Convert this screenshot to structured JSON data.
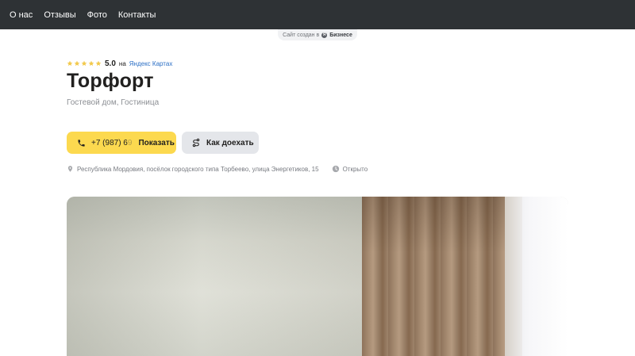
{
  "nav": {
    "items": [
      "О нас",
      "Отзывы",
      "Фото",
      "Контакты"
    ]
  },
  "badge": {
    "prefix": "Сайт создан в",
    "logo_letter": "Я",
    "brand": "Бизнесе"
  },
  "rating": {
    "stars": 5,
    "value": "5.0",
    "on": "на",
    "source": "Яндекс Картах",
    "star_color": "#f2c94c"
  },
  "business": {
    "name": "Торфорт",
    "categories": "Гостевой дом, Гостиница"
  },
  "actions": {
    "phone_visible": "+7 (987) 6",
    "phone_faded": "9",
    "show_label": "Показать",
    "route_label": "Как доехать",
    "phone_button_color": "#fcd94f"
  },
  "info": {
    "address": "Республика Мордовия, посёлок городского типа Торбеево, улица Энергетиков, 15",
    "status": "Открыто"
  },
  "icons": {
    "phone": "phone-icon",
    "route": "route-icon",
    "location": "location-pin-icon",
    "clock": "clock-icon"
  }
}
